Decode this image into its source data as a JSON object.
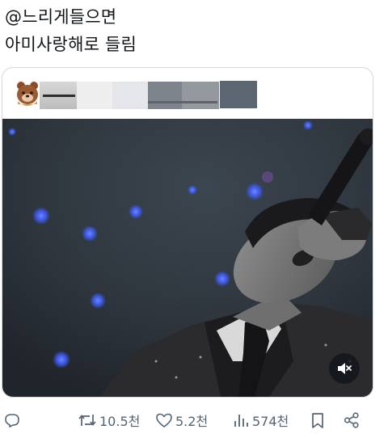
{
  "tweet": {
    "text_line1": "@느리게들으면",
    "text_line2": "아미사랑해로 들림"
  },
  "quote": {
    "author_redacted": true,
    "media": {
      "type": "video",
      "mute_icon": "speaker-muted-icon"
    }
  },
  "actions": {
    "reply": {
      "icon": "reply-icon",
      "count": ""
    },
    "retweet": {
      "icon": "retweet-icon",
      "count": "10.5천"
    },
    "like": {
      "icon": "heart-icon",
      "count": "5.2천"
    },
    "views": {
      "icon": "views-chart-icon",
      "count": "574천"
    },
    "bookmark": {
      "icon": "bookmark-icon"
    },
    "share": {
      "icon": "share-icon"
    }
  },
  "colors": {
    "text": "#0f1419",
    "muted": "#536471",
    "border": "#cfd9de",
    "stage_dark": "#2a3038",
    "stage_light": "#4a5a66",
    "bokeh_blue": "#3d5cff"
  }
}
